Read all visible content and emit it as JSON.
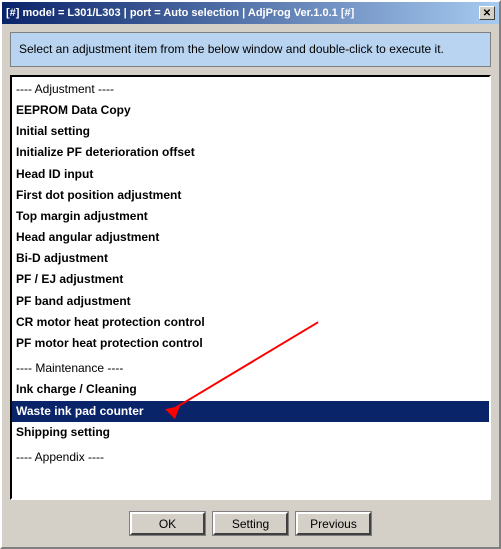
{
  "window": {
    "title": "[#] model = L301/L303 | port = Auto selection | AdjProg Ver.1.0.1 [#]",
    "close_button": "✕"
  },
  "info_box": {
    "text": "Select an adjustment item from the below window and double-click to execute it."
  },
  "list": {
    "items": [
      {
        "label": "---- Adjustment ----",
        "type": "section-header"
      },
      {
        "label": "EEPROM Data Copy",
        "type": "bold-item"
      },
      {
        "label": "Initial setting",
        "type": "bold-item"
      },
      {
        "label": "Initialize PF deterioration offset",
        "type": "bold-item"
      },
      {
        "label": "Head ID input",
        "type": "bold-item"
      },
      {
        "label": "First dot position adjustment",
        "type": "bold-item"
      },
      {
        "label": "Top margin adjustment",
        "type": "bold-item"
      },
      {
        "label": "Head angular adjustment",
        "type": "bold-item"
      },
      {
        "label": "Bi-D adjustment",
        "type": "bold-item"
      },
      {
        "label": "PF / EJ adjustment",
        "type": "bold-item"
      },
      {
        "label": "PF band adjustment",
        "type": "bold-item"
      },
      {
        "label": "CR motor heat protection control",
        "type": "bold-item"
      },
      {
        "label": "PF motor heat protection control",
        "type": "bold-item"
      },
      {
        "label": "",
        "type": "spacer"
      },
      {
        "label": "---- Maintenance ----",
        "type": "section-header"
      },
      {
        "label": "Ink charge / Cleaning",
        "type": "bold-item"
      },
      {
        "label": "Waste ink pad counter",
        "type": "bold-item selected"
      },
      {
        "label": "Shipping setting",
        "type": "bold-item"
      },
      {
        "label": "",
        "type": "spacer"
      },
      {
        "label": "---- Appendix ----",
        "type": "section-header"
      }
    ]
  },
  "buttons": {
    "ok": "OK",
    "setting": "Setting",
    "previous": "Previous"
  }
}
